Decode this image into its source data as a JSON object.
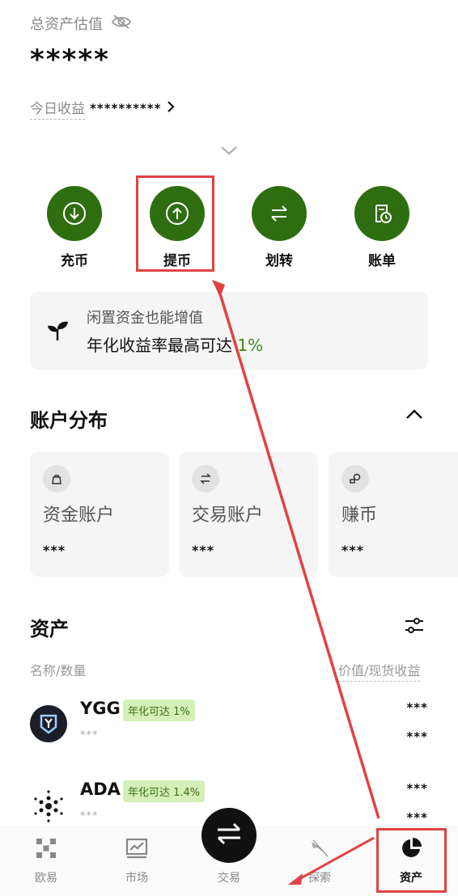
{
  "header": {
    "total_label": "总资产估值",
    "total_value": "*****",
    "today_label": "今日收益",
    "today_value": "**********",
    "today_chevron": "›"
  },
  "actions": [
    {
      "label": "充币",
      "icon": "deposit-icon"
    },
    {
      "label": "提币",
      "icon": "withdraw-icon"
    },
    {
      "label": "划转",
      "icon": "transfer-icon"
    },
    {
      "label": "账单",
      "icon": "bill-icon"
    }
  ],
  "promo": {
    "line1": "闲置资金也能增值",
    "line2_prefix": "年化收益率最高可达 ",
    "line2_rate": "1%"
  },
  "accounts": {
    "heading": "账户分布",
    "cards": [
      {
        "name": "资金账户",
        "value": "***"
      },
      {
        "name": "交易账户",
        "value": "***"
      },
      {
        "name": "赚币",
        "value": "***"
      }
    ]
  },
  "assets": {
    "heading": "资产",
    "col_left": "名称/数量",
    "col_right": "价值/现货收益",
    "rows": [
      {
        "symbol": "YGG",
        "badge": "年化可达 1%",
        "qty": "***",
        "value": "***",
        "pnl": "***"
      },
      {
        "symbol": "ADA",
        "badge": "年化可达 1.4%",
        "qty": "***",
        "value": "***",
        "pnl": "***"
      }
    ]
  },
  "nav": {
    "items": [
      {
        "label": "欧易",
        "icon": "okx-logo-icon"
      },
      {
        "label": "市场",
        "icon": "market-chart-icon"
      },
      {
        "label": "交易",
        "icon": "trade-swap-icon"
      },
      {
        "label": "探索",
        "icon": "explore-compass-icon"
      },
      {
        "label": "资产",
        "icon": "assets-pie-icon"
      }
    ]
  },
  "colors": {
    "brand_green": "#2e6e10",
    "accent_green_text": "#3c8a1a",
    "badge_bg": "#d4efb8",
    "annotation_red": "#e04343"
  }
}
